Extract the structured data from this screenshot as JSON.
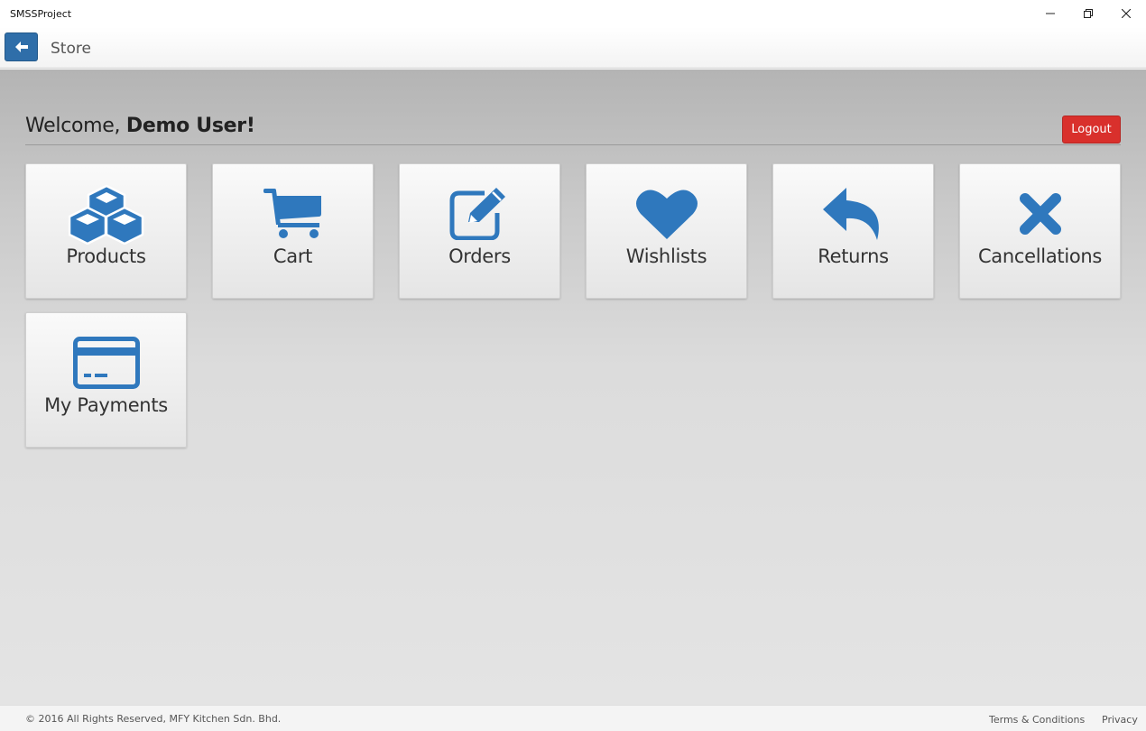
{
  "window": {
    "title": "SMSSProject",
    "controls": {
      "minimize": "minimize-icon",
      "maximize": "restore-icon",
      "close": "close-icon"
    }
  },
  "header": {
    "page_title": "Store",
    "back_icon": "arrow-left-icon"
  },
  "main": {
    "welcome_prefix": "Welcome, ",
    "user_name": "Demo User!",
    "logout_label": "Logout",
    "tiles": [
      {
        "label": "Products",
        "icon": "cubes-icon"
      },
      {
        "label": "Cart",
        "icon": "shopping-cart-icon"
      },
      {
        "label": "Orders",
        "icon": "edit-icon"
      },
      {
        "label": "Wishlists",
        "icon": "heart-icon"
      },
      {
        "label": "Returns",
        "icon": "reply-icon"
      },
      {
        "label": "Cancellations",
        "icon": "times-icon"
      },
      {
        "label": "My Payments",
        "icon": "credit-card-icon"
      }
    ]
  },
  "footer": {
    "copyright": "© 2016 All Rights Reserved, MFY Kitchen Sdn. Bhd.",
    "terms_label": "Terms & Conditions",
    "privacy_label": "Privacy"
  },
  "colors": {
    "accent": "#2f78bd",
    "logout": "#d9302c",
    "back_button": "#2f6ea9"
  }
}
